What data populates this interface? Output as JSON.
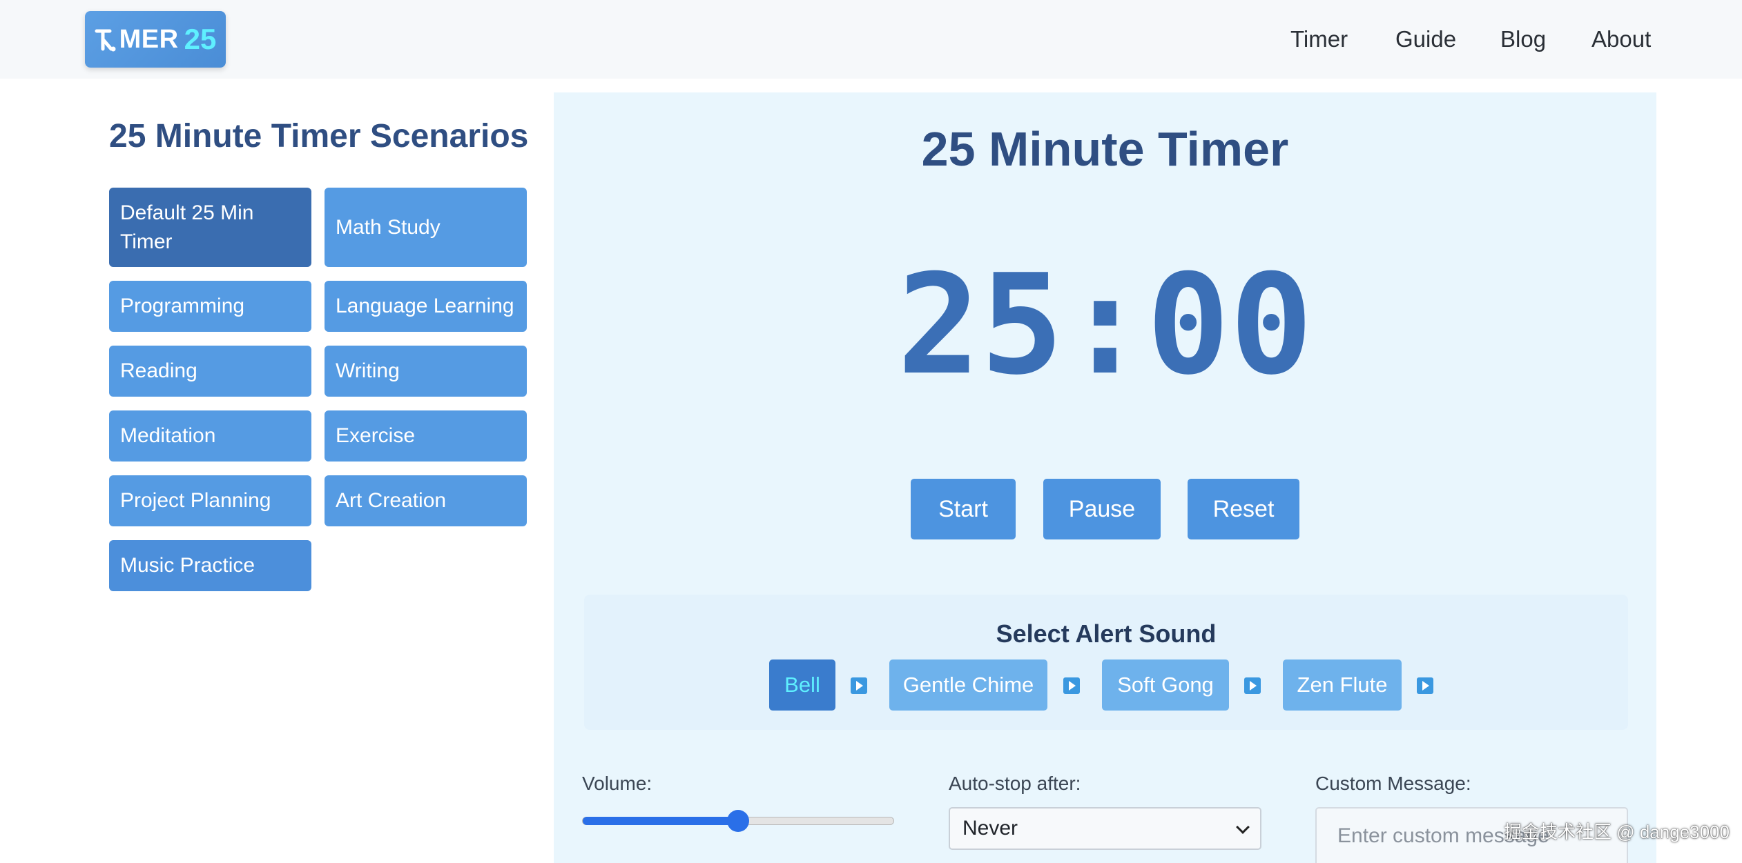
{
  "header": {
    "logo_text": "MER",
    "logo_num": "25",
    "logo_glyph": "T",
    "nav": [
      "Timer",
      "Guide",
      "Blog",
      "About"
    ]
  },
  "sidebar": {
    "title": "25 Minute Timer Scenarios",
    "scenarios": [
      "Default 25 Min Timer",
      "Math Study",
      "Programming",
      "Language Learning",
      "Reading",
      "Writing",
      "Meditation",
      "Exercise",
      "Project Planning",
      "Art Creation",
      "Music Practice"
    ],
    "active_index": 0
  },
  "timer": {
    "title": "25 Minute Timer",
    "display": "25:00",
    "controls": [
      "Start",
      "Pause",
      "Reset"
    ]
  },
  "alert": {
    "title": "Select Alert Sound",
    "sounds": [
      "Bell",
      "Gentle Chime",
      "Soft Gong",
      "Zen Flute"
    ],
    "selected": "Bell",
    "play_icon": "play-icon"
  },
  "settings": {
    "volume_label": "Volume:",
    "volume_value": 0.5,
    "autostop_label": "Auto-stop after:",
    "autostop_value": "Never",
    "message_label": "Custom Message:",
    "message_placeholder": "Enter custom message"
  },
  "watermark": "掘金技术社区 @ dange3000",
  "colors": {
    "accent": "#559be3",
    "accent_dark": "#3a6db0",
    "title": "#2f4e82",
    "panel_bg": "#e9f6fd",
    "highlight": "#5ff0ff"
  }
}
